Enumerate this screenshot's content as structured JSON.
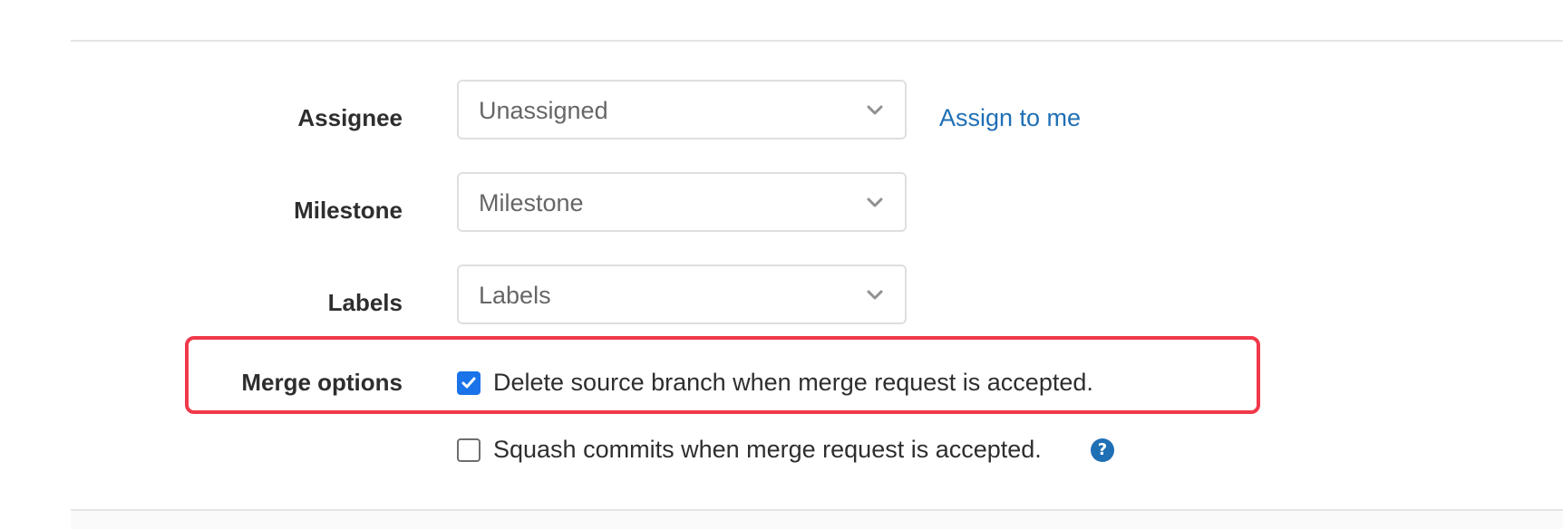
{
  "form": {
    "assignee": {
      "label": "Assignee",
      "value": "Unassigned",
      "assign_link": "Assign to me"
    },
    "milestone": {
      "label": "Milestone",
      "value": "Milestone"
    },
    "labels": {
      "label": "Labels",
      "value": "Labels"
    },
    "merge_options": {
      "label": "Merge options",
      "delete_source": {
        "label": "Delete source branch when merge request is accepted.",
        "checked": true
      },
      "squash": {
        "label": "Squash commits when merge request is accepted.",
        "checked": false,
        "help_icon": "?"
      }
    }
  },
  "colors": {
    "link": "#1f6fb5",
    "checkbox_checked": "#1a73e8",
    "highlight": "#f0394a"
  }
}
